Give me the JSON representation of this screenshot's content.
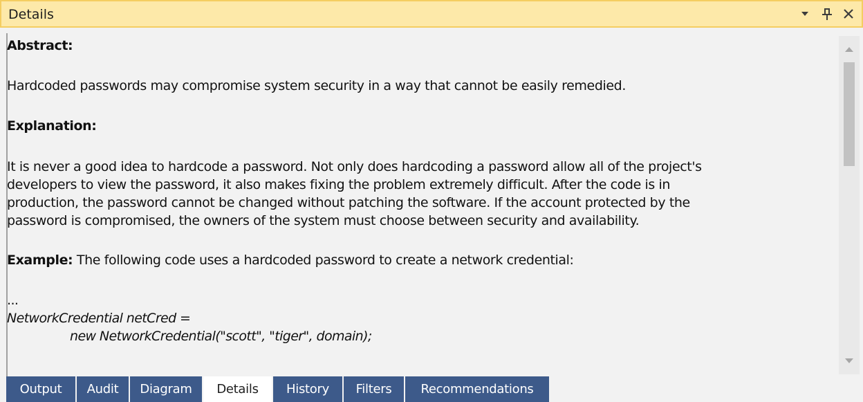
{
  "panel": {
    "title": "Details"
  },
  "content": {
    "abstract_heading": "Abstract:",
    "abstract_text": "Hardcoded passwords may compromise system security in a way that cannot be easily remedied.",
    "explanation_heading": "Explanation:",
    "explanation_lines": [
      "It is never a good idea to hardcode a password. Not only does hardcoding a password allow all of the project's",
      "developers to view the password, it also makes fixing the problem extremely difficult. After the code is in",
      "production, the password cannot be changed without patching the software. If the account protected by the",
      "password is compromised, the owners of the system must choose between security and availability."
    ],
    "example_heading": "Example:",
    "example_text": " The following code uses a hardcoded password to create a network credential:",
    "code_lines": [
      "...",
      "NetworkCredential netCred =",
      "new NetworkCredential(\"scott\", \"tiger\", domain);"
    ]
  },
  "tabs": [
    {
      "label": "Output",
      "active": false
    },
    {
      "label": "Audit",
      "active": false
    },
    {
      "label": "Diagram",
      "active": false
    },
    {
      "label": "Details",
      "active": true
    },
    {
      "label": "History",
      "active": false
    },
    {
      "label": "Filters",
      "active": false
    },
    {
      "label": "Recommendations",
      "active": false
    }
  ],
  "icons": {
    "dropdown": "chevron-down-icon",
    "pin": "pin-icon",
    "close": "close-icon",
    "scroll_up": "arrow-up-icon",
    "scroll_down": "arrow-down-icon"
  },
  "colors": {
    "titlebar_bg": "#fde9a9",
    "titlebar_border": "#f4cd61",
    "tab_bg": "#3d5a8a",
    "tab_active_bg": "#ffffff"
  }
}
